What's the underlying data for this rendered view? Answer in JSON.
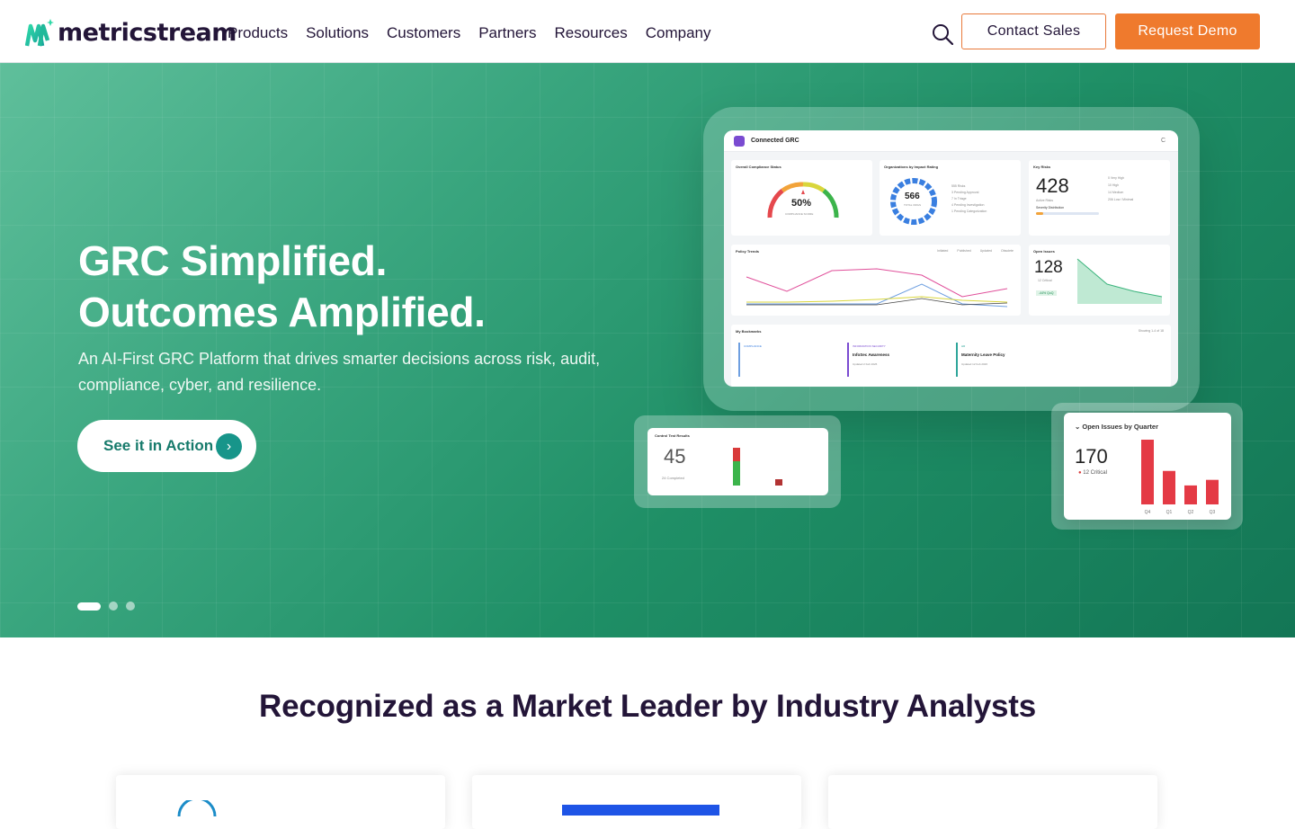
{
  "brand": {
    "name": "metricstream",
    "accent": "#ef7a2d",
    "hero_green": "#1f8f66",
    "dark": "#231538"
  },
  "nav": {
    "items": [
      "Products",
      "Solutions",
      "Customers",
      "Partners",
      "Resources",
      "Company"
    ]
  },
  "header": {
    "search_icon": "search-icon",
    "contact_label": "Contact Sales",
    "demo_label": "Request Demo"
  },
  "hero": {
    "title_line1": "GRC Simplified.",
    "title_line2": "Outcomes Amplified.",
    "subtitle": "An AI-First GRC Platform that drives smarter decisions across risk, audit, compliance, cyber, and resilience.",
    "cta_label": "See it in Action",
    "cta_icon": "chevron-right-icon",
    "slides": 3,
    "active_slide": 1
  },
  "dashboard": {
    "title": "Connected GRC",
    "compliance": {
      "label": "Overall Compliance Status",
      "value": "50%",
      "sub": "COMPLIANCE SCORE"
    },
    "orgs": {
      "label": "Organizations by Impact Rating",
      "value": "566",
      "sub": "TOTAL ORGS",
      "legend": [
        "555 Risks",
        "3 Pending Approval",
        "7 In Triage",
        "4 Pending Investigation",
        "1 Pending Categorization"
      ]
    },
    "key_risks": {
      "label": "Key Risks",
      "value": "428",
      "sub": "Active Risks",
      "dist_label": "Severity Distribution",
      "legend": [
        "0 Very High",
        "10 High",
        "14 Medium",
        "206 Low / Minimal"
      ]
    },
    "policy_trends": {
      "label": "Policy Trends",
      "legend": [
        "Initiated",
        "Published",
        "Updated",
        "Obsolete"
      ]
    },
    "open_issues": {
      "label": "Open Issues",
      "value": "128",
      "critical": "12 Critical",
      "delta": "-44% QoQ"
    },
    "bookmarks": {
      "label": "My Bookmarks",
      "paging": "Showing 1-4 of 18",
      "items": [
        {
          "tag": "COMPLIANCE",
          "title": "",
          "meta": ""
        },
        {
          "tag": "INFORMATION SECURITY",
          "title": "InfoSec Awareness",
          "meta": "Updated 2 Feb 2026"
        },
        {
          "tag": "HR",
          "title": "Maternity Leave Policy",
          "meta": "Updated 12 Feb 2026"
        }
      ]
    },
    "control_tests": {
      "label": "Control Test Results",
      "value": "45",
      "sub": "24 Completed"
    },
    "issues_quarter": {
      "label": "Open Issues by Quarter",
      "value": "170",
      "critical": "12 Critical",
      "quarters": [
        "Q4",
        "Q1",
        "Q2",
        "Q3"
      ],
      "values": [
        58,
        30,
        17,
        22
      ]
    }
  },
  "analysts": {
    "title": "Recognized as a Market Leader by Industry Analysts"
  }
}
